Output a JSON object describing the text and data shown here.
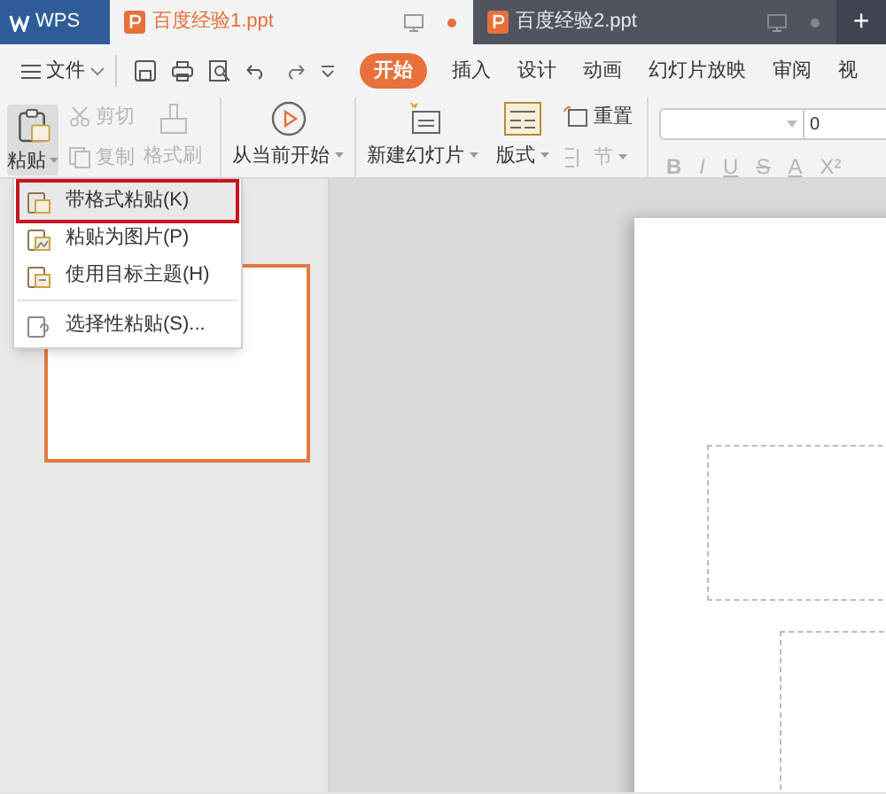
{
  "app_logo": "WPS",
  "doc_tabs": [
    {
      "title": "百度经验1.ppt",
      "selected": true,
      "modified": true
    },
    {
      "title": "百度经验2.ppt",
      "selected": false,
      "modified": false
    }
  ],
  "new_tab": "+",
  "file_menu": "文件",
  "ribbon_tabs": [
    {
      "label": "开始",
      "selected": true
    },
    {
      "label": "插入",
      "selected": false
    },
    {
      "label": "设计",
      "selected": false
    },
    {
      "label": "动画",
      "selected": false
    },
    {
      "label": "幻灯片放映",
      "selected": false
    },
    {
      "label": "审阅",
      "selected": false
    },
    {
      "label": "视",
      "selected": false
    }
  ],
  "toolbar": {
    "paste": "粘贴",
    "cut": {
      "label": "剪切",
      "disabled": true
    },
    "copy": {
      "label": "复制",
      "disabled": true
    },
    "format_painter": {
      "label": "格式刷",
      "disabled": true
    },
    "from_current": "从当前开始",
    "new_slide": "新建幻灯片",
    "layout": "版式",
    "reset": {
      "label": "重置",
      "disabled": false
    },
    "section": {
      "label": "节",
      "disabled": true
    },
    "font_size": "0",
    "font_buttons": [
      "B",
      "I",
      "U",
      "S",
      "A",
      "X²"
    ]
  },
  "paste_menu": [
    {
      "label": "带格式粘贴(K)",
      "selected": true
    },
    {
      "label": "粘贴为图片(P)",
      "selected": false
    },
    {
      "label": "使用目标主题(H)",
      "selected": false
    },
    {
      "label": "选择性粘贴(S)...",
      "selected": false
    }
  ],
  "thumbnails": [
    {
      "selected": true
    }
  ]
}
